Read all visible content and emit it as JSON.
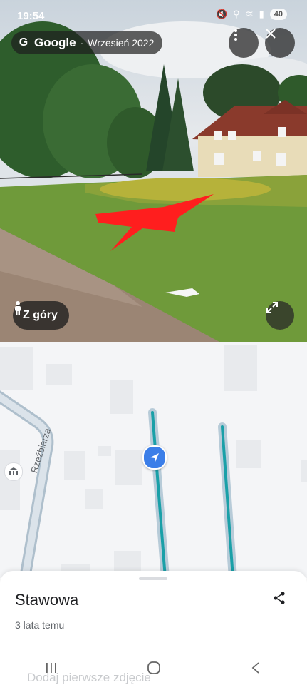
{
  "status_bar": {
    "time": "19:54",
    "battery": "40"
  },
  "top_bar": {
    "brand": "Google",
    "separator": "·",
    "date": "Wrzesień 2022"
  },
  "photo_controls": {
    "view_mode_label": "Z góry"
  },
  "map": {
    "street_name": "Rzeźbiarza"
  },
  "place": {
    "title": "Stawowa",
    "subtitle": "3 lata temu",
    "add_photo_prompt": "Dodaj pierwsze zdjęcie"
  },
  "icons": {
    "google": "google-g-icon",
    "more": "more-vert-icon",
    "close": "close-icon",
    "pegman": "pegman-icon",
    "expand": "expand-icon",
    "share": "share-icon",
    "navigation": "navigation-arrow-icon",
    "poi": "museum-icon"
  },
  "colors": {
    "route": "#1aa0a8",
    "marker": "#3b7ee8",
    "overlay": "#1e1e1e"
  }
}
